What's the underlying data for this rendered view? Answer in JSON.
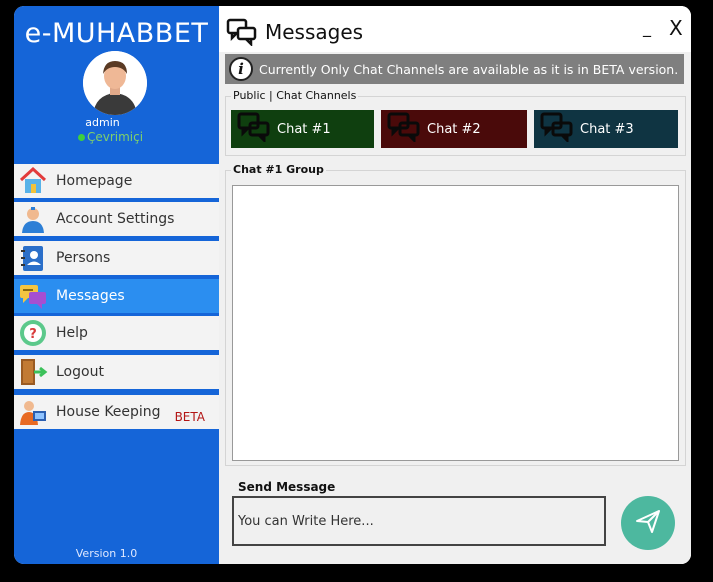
{
  "sidebar": {
    "brand": "e-MUHABBET",
    "username": "admin",
    "status": "Çevrimiçi",
    "version": "Version 1.0",
    "items": [
      {
        "label": "Homepage",
        "icon": "home-icon"
      },
      {
        "label": "Account Settings",
        "icon": "user-settings-icon"
      },
      {
        "label": "Persons",
        "icon": "contacts-book-icon"
      },
      {
        "label": "Messages",
        "icon": "chat-bubbles-icon",
        "active": true
      },
      {
        "label": "Help",
        "icon": "help-icon"
      },
      {
        "label": "Logout",
        "icon": "logout-door-icon"
      },
      {
        "label": "House Keeping",
        "icon": "housekeeping-icon",
        "badge": "BETA"
      }
    ]
  },
  "header": {
    "title": "Messages",
    "minimize": "_",
    "close": "X"
  },
  "notice": {
    "icon": "i",
    "text": "Currently Only Chat Channels are available as it is in BETA version."
  },
  "channels": {
    "group_label": "Public | Chat Channels",
    "items": [
      {
        "label": "Chat #1",
        "color": "#0f3f0f"
      },
      {
        "label": "Chat #2",
        "color": "#4a0a0a"
      },
      {
        "label": "Chat #3",
        "color": "#0f3442"
      }
    ]
  },
  "chat": {
    "group_label": "Chat #1 Group"
  },
  "send": {
    "label": "Send Message",
    "placeholder": "You can Write Here..."
  },
  "colors": {
    "sidebar_bg": "#1565d8",
    "active_item": "#2b8ef0",
    "send_button": "#4db89f",
    "beta": "#b31515"
  }
}
